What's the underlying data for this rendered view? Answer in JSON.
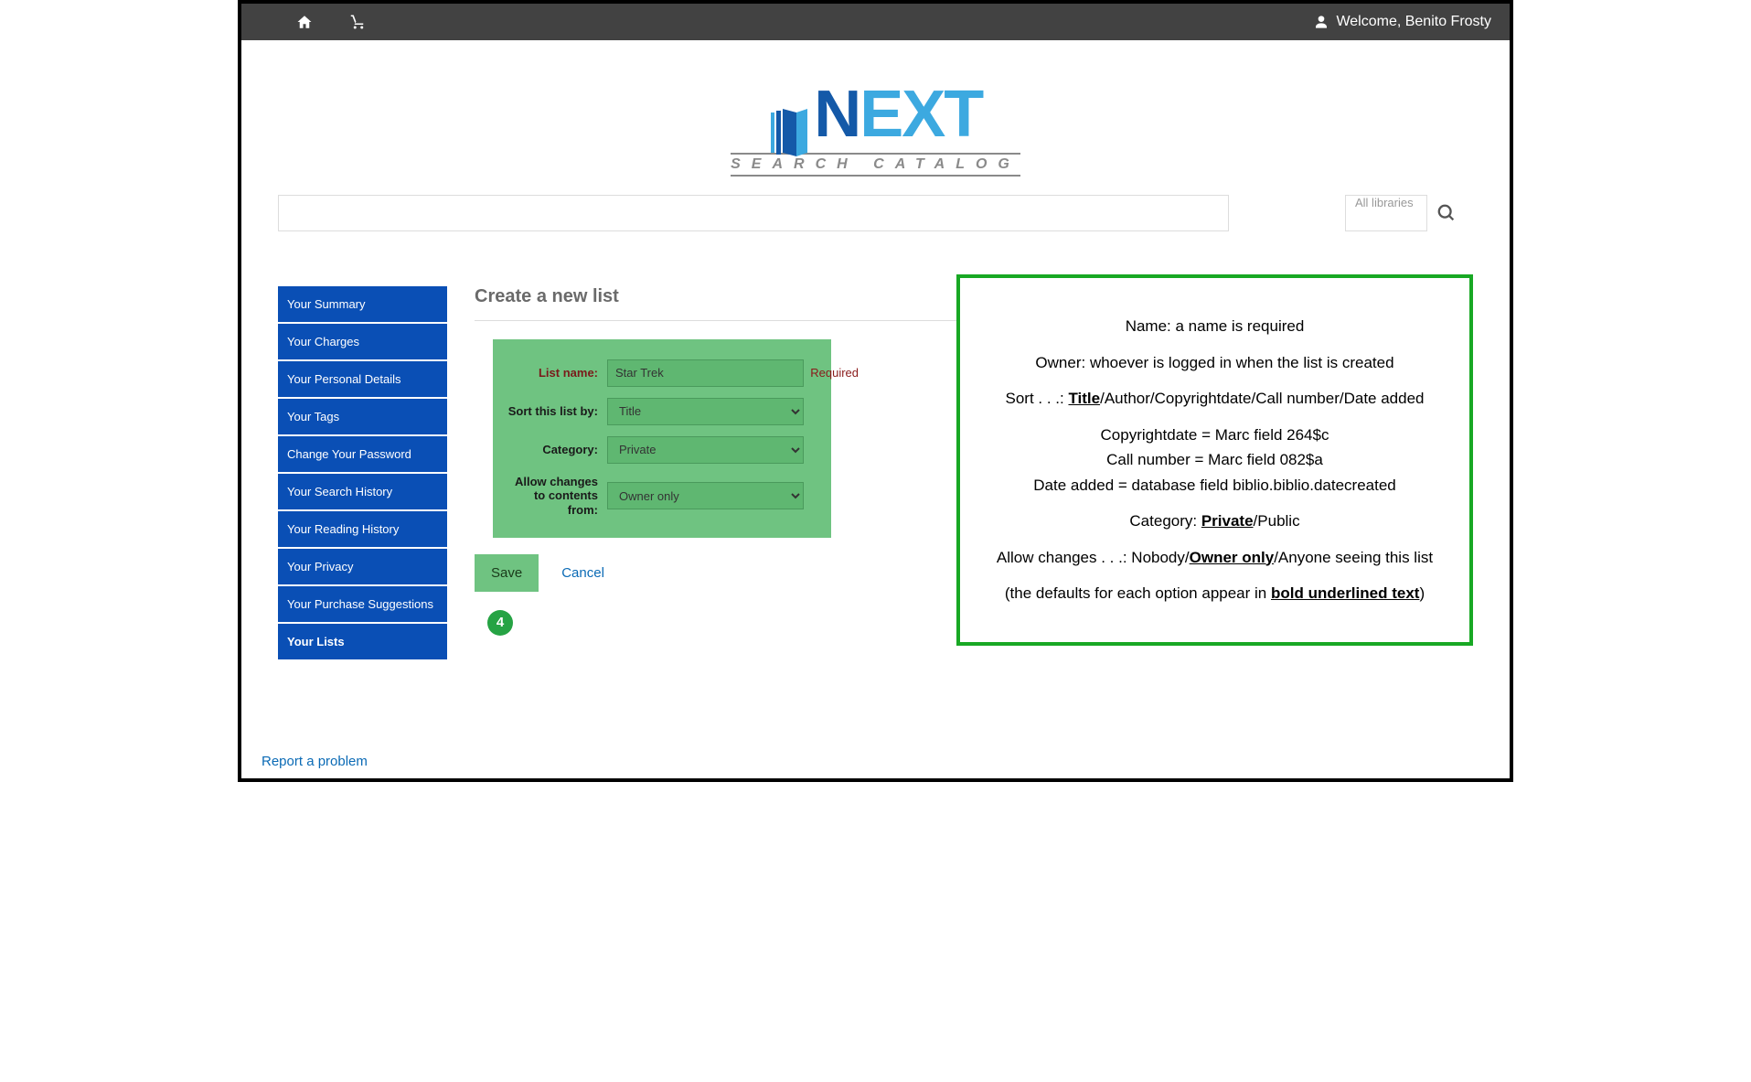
{
  "topbar": {
    "welcome_prefix": "Welcome, ",
    "user_name": "Benito Frosty"
  },
  "logo": {
    "brand_n": "N",
    "brand_ext": "EXT",
    "subtitle": "SEARCH CATALOG"
  },
  "search": {
    "library_placeholder": "All libraries"
  },
  "sidebar": {
    "items": [
      {
        "label": "Your Summary"
      },
      {
        "label": "Your Charges"
      },
      {
        "label": "Your Personal Details"
      },
      {
        "label": "Your Tags"
      },
      {
        "label": "Change Your Password"
      },
      {
        "label": "Your Search History"
      },
      {
        "label": "Your Reading History"
      },
      {
        "label": "Your Privacy"
      },
      {
        "label": "Your Purchase Suggestions"
      },
      {
        "label": "Your Lists"
      }
    ]
  },
  "page": {
    "title": "Create a new list"
  },
  "form": {
    "name_label": "List name:",
    "name_value": "Star Trek",
    "required_text": "Required",
    "sort_label": "Sort this list by:",
    "sort_value": "Title",
    "category_label": "Category:",
    "category_value": "Private",
    "allow_label": "Allow changes to contents from:",
    "allow_value": "Owner only",
    "save_label": "Save",
    "cancel_label": "Cancel",
    "step_number": "4"
  },
  "info": {
    "name_line": "Name: a name is required",
    "owner_line": "Owner: whoever is logged in when the list is created",
    "sort_prefix": "Sort . . .: ",
    "sort_default": "Title",
    "sort_rest": "/Author/Copyrightdate/Call number/Date added",
    "copyright_line": "Copyrightdate = Marc field 264$c",
    "callnum_line": "Call number = Marc field 082$a",
    "dateadded_line": "Date added = database field biblio.biblio.datecreated",
    "cat_prefix": "Category: ",
    "cat_default": "Private",
    "cat_rest": "/Public",
    "allow_prefix": "Allow changes . . .: Nobody/",
    "allow_default": "Owner only",
    "allow_rest": "/Anyone seeing this list",
    "defaults_prefix": "(the defaults for each option appear in ",
    "defaults_bold": "bold underlined text",
    "defaults_suffix": ")"
  },
  "footer": {
    "report_label": "Report a problem"
  }
}
